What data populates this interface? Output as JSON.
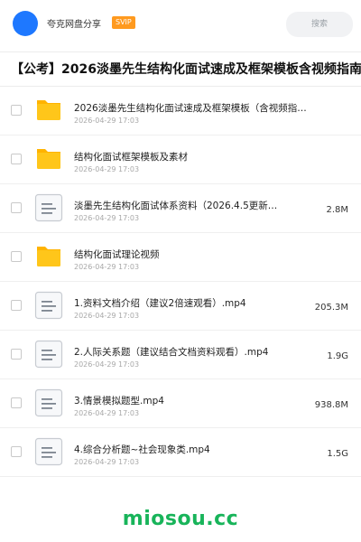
{
  "header": {
    "username": "夸克网盘分享",
    "vip_badge": "SVIP",
    "search_placeholder": "搜索"
  },
  "title": "【公考】2026淡墨先生结构化面试速成及框架模板含视频指南",
  "files": [
    {
      "type": "folder",
      "name": "2026淡墨先生结构化面试速成及框架模板（含视频指…",
      "date": "2026-04-29 17:03",
      "size": ""
    },
    {
      "type": "folder",
      "name": "结构化面试框架模板及素材",
      "date": "2026-04-29 17:03",
      "size": ""
    },
    {
      "type": "doc",
      "name": "淡墨先生结构化面试体系资料（2026.4.5更新）…",
      "date": "2026-04-29 17:03",
      "size": "2.8M"
    },
    {
      "type": "folder",
      "name": "结构化面试理论视频",
      "date": "2026-04-29 17:03",
      "size": ""
    },
    {
      "type": "doc",
      "name": "1.资料文档介绍（建议2倍速观看）.mp4",
      "date": "2026-04-29 17:03",
      "size": "205.3M"
    },
    {
      "type": "doc",
      "name": "2.人际关系题（建议结合文档资料观看）.mp4",
      "date": "2026-04-29 17:03",
      "size": "1.9G"
    },
    {
      "type": "doc",
      "name": "3.情景模拟题型.mp4",
      "date": "2026-04-29 17:03",
      "size": "938.8M"
    },
    {
      "type": "doc",
      "name": "4.综合分析题~社会现象类.mp4",
      "date": "2026-04-29 17:03",
      "size": "1.5G"
    }
  ],
  "watermark": "miosou.cc",
  "colors": {
    "accent_blue": "#1e78ff",
    "vip_orange": "#ff9a1f",
    "folder_yellow": "#ffc61a",
    "watermark_green": "#18b45a"
  }
}
